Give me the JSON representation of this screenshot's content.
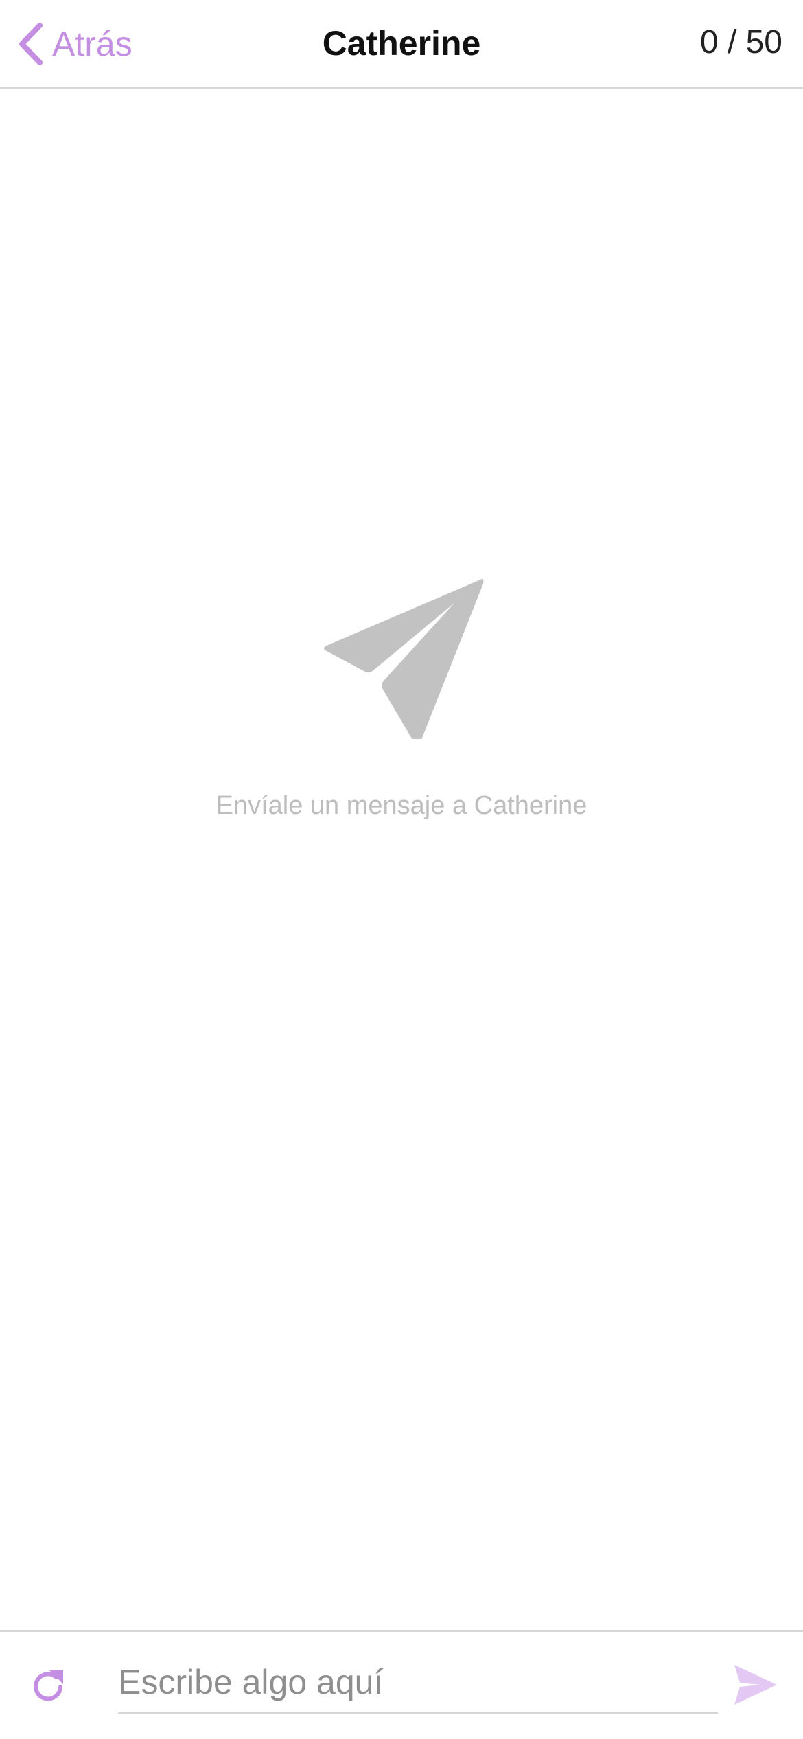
{
  "header": {
    "back_label": "Atrás",
    "title": "Catherine",
    "counter": "0 / 50"
  },
  "empty_state": {
    "icon": "paper-plane-icon",
    "message": "Envíale un mensaje a Catherine"
  },
  "composer": {
    "refresh_icon": "refresh-icon",
    "input_value": "",
    "input_placeholder": "Escribe algo aquí",
    "send_icon": "send-icon"
  },
  "colors": {
    "accent": "#c48fe3",
    "send_disabled": "#e3c8f4",
    "muted_icon": "#c2c2c2",
    "muted_text": "#bdbdbd",
    "divider": "#d6d6d6"
  }
}
